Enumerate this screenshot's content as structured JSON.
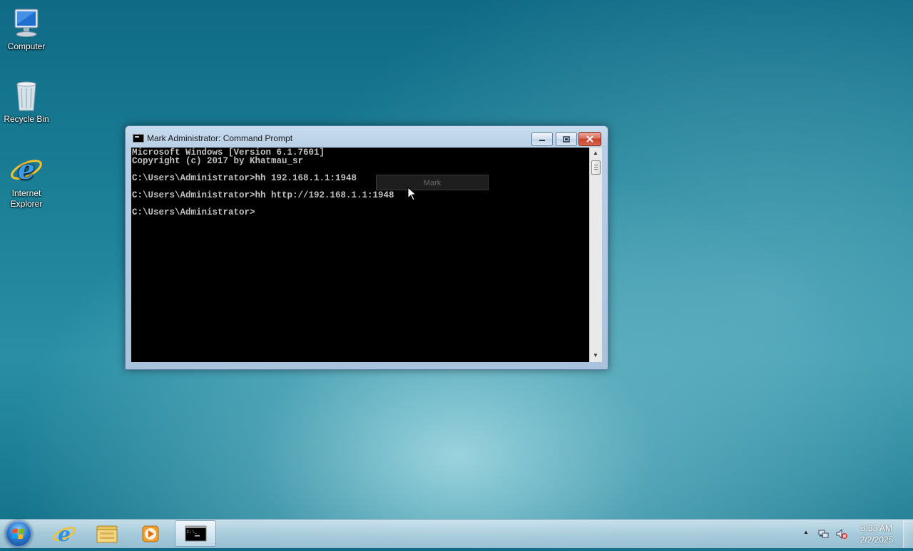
{
  "desktop": {
    "icons": [
      {
        "label": "Computer"
      },
      {
        "label": "Recycle Bin"
      },
      {
        "label": "Internet\nExplorer"
      }
    ]
  },
  "window": {
    "title": "Mark Administrator: Command Prompt",
    "console_text": "Microsoft Windows [Version 6.1.7601]\nCopyright (c) 2017 by Khatmau_sr\n\nC:\\Users\\Administrator>hh 192.168.1.1:1948\n\nC:\\Users\\Administrator>hh http://192.168.1.1:1948\n\nC:\\Users\\Administrator>",
    "tooltip": "Mark"
  },
  "taskbar": {
    "items": [
      "start-button",
      "internet-explorer",
      "windows-explorer",
      "media-player",
      "command-prompt"
    ],
    "clock_time": "8:33 AM",
    "clock_date": "2/2/2025"
  },
  "colors": {
    "console_bg": "#000000",
    "console_fg": "#c0c0c0",
    "close_button": "#c7412b"
  }
}
